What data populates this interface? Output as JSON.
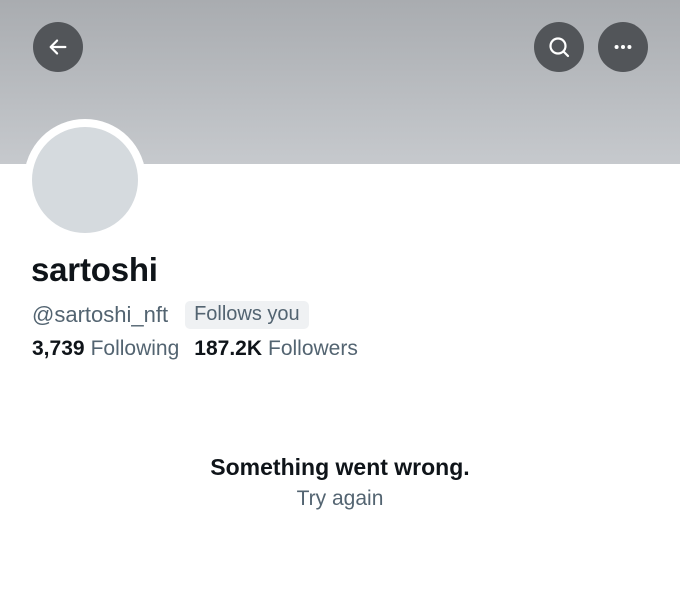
{
  "header": {
    "back_icon": "arrow-left-icon",
    "search_icon": "search-icon",
    "more_icon": "more-horizontal-icon"
  },
  "profile": {
    "name": "sartoshi",
    "handle": "@sartoshi_nft",
    "follows_badge": "Follows you",
    "following_count": "3,739",
    "following_label": "Following",
    "followers_count": "187.2K",
    "followers_label": "Followers"
  },
  "error": {
    "message": "Something went wrong.",
    "retry": "Try again"
  },
  "colors": {
    "banner": "#b4b7bb",
    "button_bg": "#525559",
    "avatar_placeholder": "#d5dade",
    "primary_text": "#0f1419",
    "secondary_text": "#536471"
  }
}
